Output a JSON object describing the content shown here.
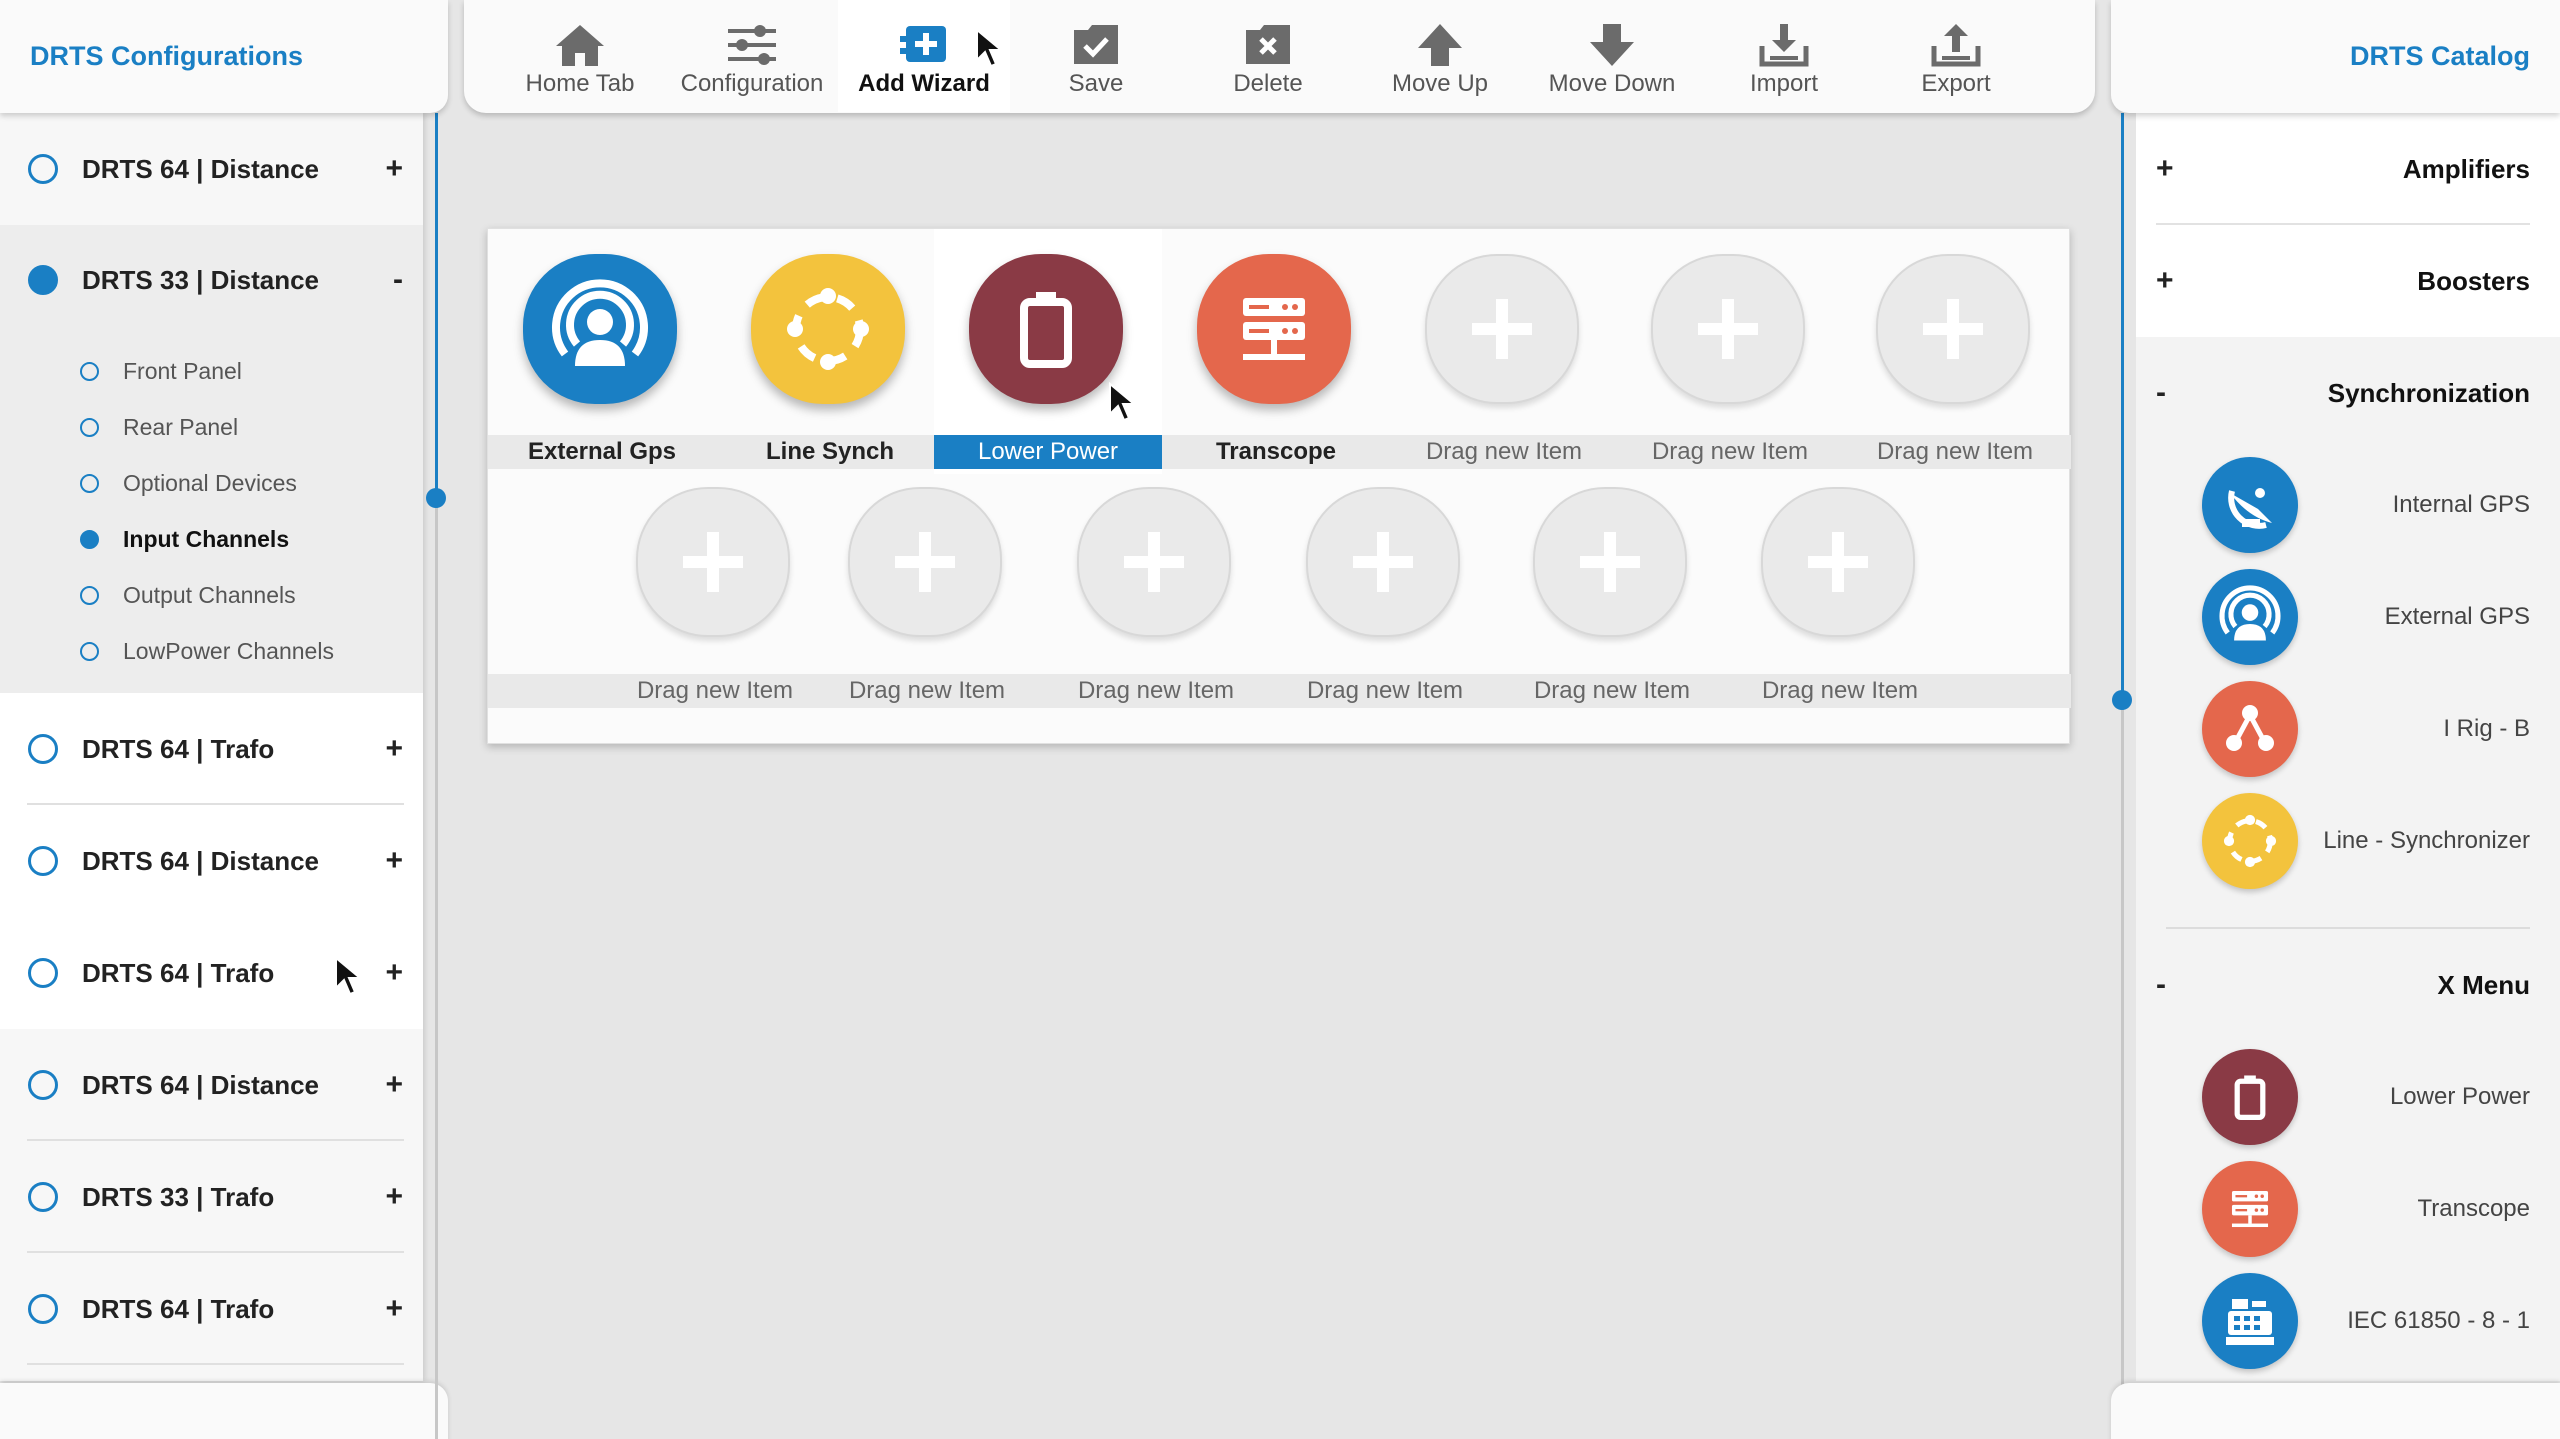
{
  "left_panel": {
    "title": "DRTS Configurations",
    "configs": [
      {
        "label": "DRTS 64 | Distance",
        "toggle": "+",
        "selected": false
      },
      {
        "label": "DRTS 33 | Distance",
        "toggle": "-",
        "selected": true,
        "children": [
          {
            "label": "Front Panel",
            "active": false
          },
          {
            "label": "Rear Panel",
            "active": false
          },
          {
            "label": "Optional Devices",
            "active": false
          },
          {
            "label": "Input Channels",
            "active": true
          },
          {
            "label": "Output Channels",
            "active": false
          },
          {
            "label": "LowPower Channels",
            "active": false
          }
        ]
      },
      {
        "label": "DRTS 64 | Trafo",
        "toggle": "+",
        "selected": false
      },
      {
        "label": "DRTS 64 | Distance",
        "toggle": "+",
        "selected": false
      },
      {
        "label": "DRTS 64 | Trafo",
        "toggle": "+",
        "selected": false
      },
      {
        "label": "DRTS 64 | Distance",
        "toggle": "+",
        "selected": false
      },
      {
        "label": "DRTS 33 | Trafo",
        "toggle": "+",
        "selected": false
      },
      {
        "label": "DRTS 64 | Trafo",
        "toggle": "+",
        "selected": false
      }
    ]
  },
  "toolbar": {
    "buttons": [
      {
        "label": "Home Tab",
        "icon": "home-icon"
      },
      {
        "label": "Configuration",
        "icon": "sliders-icon"
      },
      {
        "label": "Add Wizard",
        "icon": "add-wizard-icon",
        "active": true
      },
      {
        "label": "Save",
        "icon": "save-icon"
      },
      {
        "label": "Delete",
        "icon": "delete-icon"
      },
      {
        "label": "Move Up",
        "icon": "arrow-up-icon"
      },
      {
        "label": "Move Down",
        "icon": "arrow-down-icon"
      },
      {
        "label": "Import",
        "icon": "import-icon"
      },
      {
        "label": "Export",
        "icon": "export-icon"
      }
    ]
  },
  "workspace": {
    "row1": [
      {
        "label": "External Gps",
        "icon": "broadcast-icon",
        "color": "#1a7fc4",
        "empty": false
      },
      {
        "label": "Line Synch",
        "icon": "sync-ring-icon",
        "color": "#f3c33d",
        "empty": false
      },
      {
        "label": "Lower Power",
        "icon": "battery-icon",
        "color": "#8a3a45",
        "empty": false,
        "selected": true
      },
      {
        "label": "Transcope",
        "icon": "server-icon",
        "color": "#e4674c",
        "empty": false
      },
      {
        "label": "Drag new Item",
        "empty": true
      },
      {
        "label": "Drag new Item",
        "empty": true
      },
      {
        "label": "Drag new Item",
        "empty": true
      }
    ],
    "row2": [
      {
        "label": "Drag new Item",
        "empty": true
      },
      {
        "label": "Drag new Item",
        "empty": true
      },
      {
        "label": "Drag new Item",
        "empty": true
      },
      {
        "label": "Drag new Item",
        "empty": true
      },
      {
        "label": "Drag new Item",
        "empty": true
      },
      {
        "label": "Drag new Item",
        "empty": true
      }
    ]
  },
  "right_panel": {
    "title": "DRTS Catalog",
    "collapsed": [
      {
        "title": "Amplifiers",
        "toggle": "+"
      },
      {
        "title": "Boosters",
        "toggle": "+"
      }
    ],
    "sync": {
      "title": "Synchronization",
      "toggle": "-",
      "items": [
        {
          "label": "Internal GPS",
          "icon": "satellite-dish-icon",
          "color": "#1a7fc4"
        },
        {
          "label": "External GPS",
          "icon": "broadcast-icon",
          "color": "#1a7fc4"
        },
        {
          "label": "I Rig - B",
          "icon": "network-icon",
          "color": "#e4674c"
        },
        {
          "label": "Line - Synchronizer",
          "icon": "sync-ring-icon",
          "color": "#f3c33d"
        }
      ]
    },
    "xmenu": {
      "title": "X Menu",
      "toggle": "-",
      "items": [
        {
          "label": "Lower Power",
          "icon": "battery-icon",
          "color": "#8a3a45"
        },
        {
          "label": "Transcope",
          "icon": "server-icon",
          "color": "#e4674c"
        },
        {
          "label": "IEC 61850 - 8 - 1",
          "icon": "register-icon",
          "color": "#1a7fc4"
        }
      ]
    }
  }
}
